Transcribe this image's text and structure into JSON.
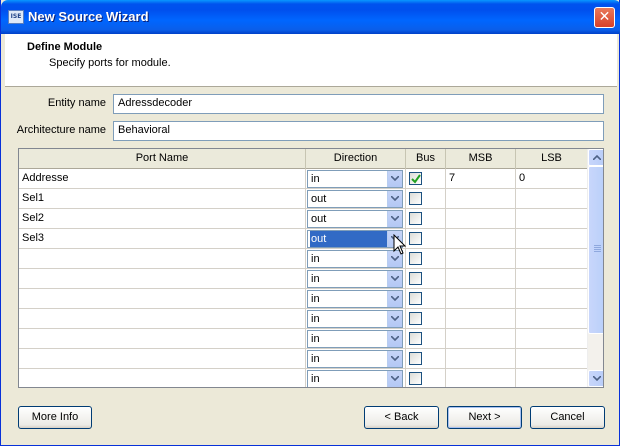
{
  "window": {
    "title": "New Source Wizard",
    "app_icon_text": "ISE",
    "close_glyph": "✕"
  },
  "header": {
    "title": "Define Module",
    "subtitle": "Specify ports for module."
  },
  "form": {
    "entity_label": "Entity name",
    "entity_value": "Adressdecoder",
    "architecture_label": "Architecture name",
    "architecture_value": "Behavioral"
  },
  "ports_table": {
    "columns": [
      "Port Name",
      "Direction",
      "Bus",
      "MSB",
      "LSB"
    ],
    "rows": [
      {
        "name": "Addresse",
        "direction": "in",
        "bus": true,
        "msb": "7",
        "lsb": "0"
      },
      {
        "name": "Sel1",
        "direction": "out",
        "bus": false,
        "msb": "",
        "lsb": ""
      },
      {
        "name": "Sel2",
        "direction": "out",
        "bus": false,
        "msb": "",
        "lsb": ""
      },
      {
        "name": "Sel3",
        "direction": "out",
        "bus": false,
        "msb": "",
        "lsb": "",
        "selected": true
      },
      {
        "name": "",
        "direction": "in",
        "bus": false,
        "msb": "",
        "lsb": ""
      },
      {
        "name": "",
        "direction": "in",
        "bus": false,
        "msb": "",
        "lsb": ""
      },
      {
        "name": "",
        "direction": "in",
        "bus": false,
        "msb": "",
        "lsb": ""
      },
      {
        "name": "",
        "direction": "in",
        "bus": false,
        "msb": "",
        "lsb": ""
      },
      {
        "name": "",
        "direction": "in",
        "bus": false,
        "msb": "",
        "lsb": ""
      },
      {
        "name": "",
        "direction": "in",
        "bus": false,
        "msb": "",
        "lsb": ""
      },
      {
        "name": "",
        "direction": "in",
        "bus": false,
        "msb": "",
        "lsb": ""
      }
    ]
  },
  "buttons": {
    "more_info": "More Info",
    "back": "< Back",
    "next": "Next >",
    "cancel": "Cancel"
  },
  "colors": {
    "titlebar": "#0053ee",
    "selection": "#316ac5",
    "checkmark": "#21a121"
  }
}
